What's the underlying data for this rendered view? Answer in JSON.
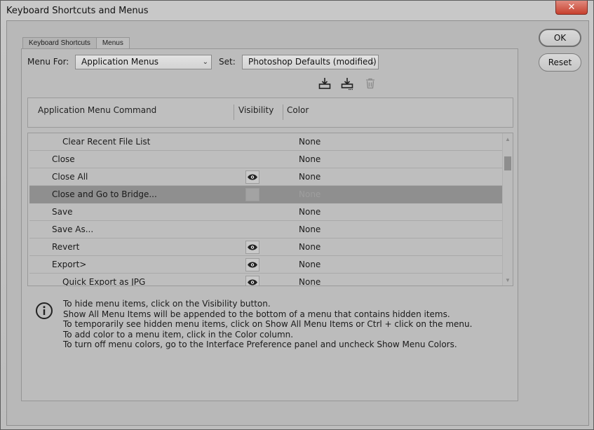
{
  "window": {
    "title": "Keyboard Shortcuts and Menus",
    "close_glyph": "✕"
  },
  "tabs": [
    {
      "label": "Keyboard Shortcuts",
      "active": false
    },
    {
      "label": "Menus",
      "active": true
    }
  ],
  "controls": {
    "menu_for_label": "Menu For:",
    "menu_for_value": "Application Menus",
    "set_label": "Set:",
    "set_value": "Photoshop Defaults (modified)",
    "toolbar_icons": [
      "save-icon",
      "save-as-icon",
      "delete-icon"
    ]
  },
  "table": {
    "headers": {
      "command": "Application Menu Command",
      "visibility": "Visibility",
      "color": "Color"
    },
    "rows": [
      {
        "command": "Clear Recent File List",
        "indent": 2,
        "visibility": "none",
        "color": "None",
        "selected": false
      },
      {
        "command": "Close",
        "indent": 1,
        "visibility": "none",
        "color": "None",
        "selected": false
      },
      {
        "command": "Close All",
        "indent": 1,
        "visibility": "eye",
        "color": "None",
        "selected": false
      },
      {
        "command": "Close and Go to Bridge...",
        "indent": 1,
        "visibility": "blank",
        "color": "None",
        "selected": true
      },
      {
        "command": "Save",
        "indent": 1,
        "visibility": "none",
        "color": "None",
        "selected": false
      },
      {
        "command": "Save As...",
        "indent": 1,
        "visibility": "none",
        "color": "None",
        "selected": false
      },
      {
        "command": "Revert",
        "indent": 1,
        "visibility": "eye",
        "color": "None",
        "selected": false
      },
      {
        "command": "Export>",
        "indent": 1,
        "visibility": "eye",
        "color": "None",
        "selected": false
      },
      {
        "command": "Quick Export as JPG",
        "indent": 2,
        "visibility": "eye",
        "color": "None",
        "selected": false
      }
    ]
  },
  "info_lines": [
    "To hide menu items, click on the Visibility button.",
    "Show All Menu Items will be appended to the bottom of a menu that contains hidden items.",
    "To temporarily see hidden menu items, click on Show All Menu Items or Ctrl + click on the menu.",
    "To add color to a menu item, click in the Color column.",
    "To turn off menu colors, go to the Interface Preference panel and uncheck Show Menu Colors."
  ],
  "buttons": {
    "ok": "OK",
    "reset": "Reset"
  }
}
